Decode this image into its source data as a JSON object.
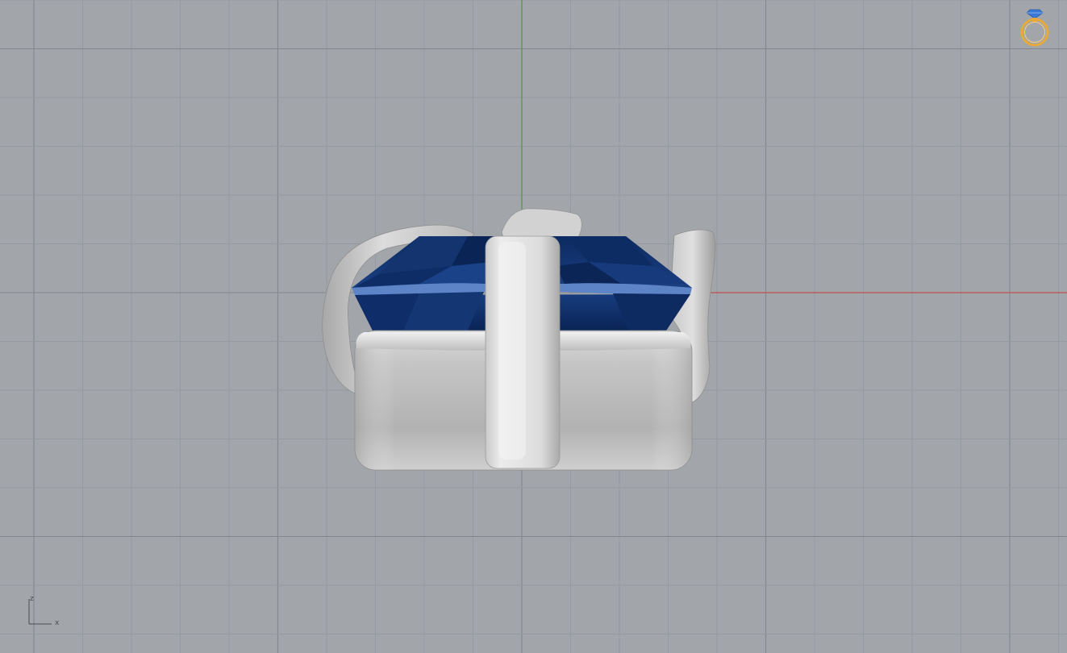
{
  "viewport": {
    "background_color": "#a2a6ab",
    "grid_minor_color": "#959aa0",
    "grid_major_color": "#83878d",
    "x_axis_color": "#c0504d",
    "y_axis_color": "#4f9a3a"
  },
  "gem": {
    "color_dark": "#0b2a5e",
    "color_mid": "#1e4b93",
    "color_light": "#5b82c6"
  },
  "metal": {
    "color_light": "#e6e6e6",
    "color_mid": "#c6c6c6",
    "color_dark": "#8f8f8f"
  },
  "axis_gizmo": {
    "z_label": "z",
    "x_label": "x"
  },
  "ring_icon": {
    "icon": "ring-icon",
    "gem_color": "#3a78d6",
    "band_color": "#e8a93a"
  }
}
